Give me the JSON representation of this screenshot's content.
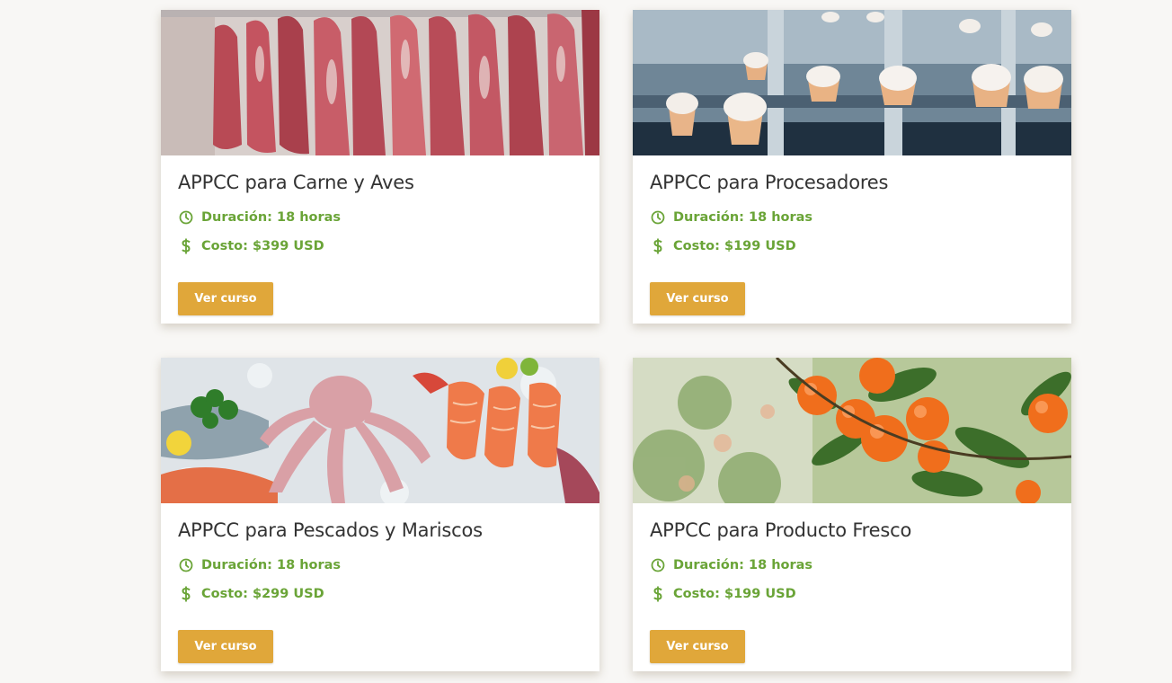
{
  "courses": [
    {
      "title": "APPCC para Carne y Aves",
      "duration": "Duración: 18 horas",
      "cost": "Costo: $399 USD",
      "button": "Ver curso",
      "image": "hanging-meat-carcasses"
    },
    {
      "title": "APPCC para Procesadores",
      "duration": "Duración: 18 horas",
      "cost": "Costo: $199 USD",
      "button": "Ver curso",
      "image": "ice-cream-production-line"
    },
    {
      "title": "APPCC para Pescados y Mariscos",
      "duration": "Duración: 18 horas",
      "cost": "Costo: $299 USD",
      "button": "Ver curso",
      "image": "seafood-on-ice"
    },
    {
      "title": "APPCC para Producto Fresco",
      "duration": "Duración: 18 horas",
      "cost": "Costo: $199 USD",
      "button": "Ver curso",
      "image": "oranges-on-tree"
    }
  ],
  "icons": {
    "duration": "clock-icon",
    "cost": "dollar-icon"
  },
  "colors": {
    "accent": "#6aa437",
    "button": "#e0a73a",
    "background": "#f8f7f5"
  }
}
